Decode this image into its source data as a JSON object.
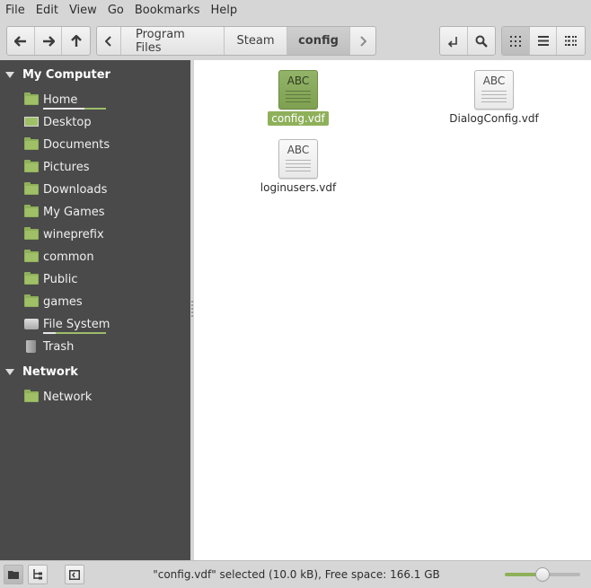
{
  "menu": [
    "File",
    "Edit",
    "View",
    "Go",
    "Bookmarks",
    "Help"
  ],
  "breadcrumb": [
    "Program Files",
    "Steam",
    "config"
  ],
  "sidebar": {
    "sections": [
      {
        "title": "My Computer",
        "items": [
          {
            "label": "Home",
            "icon": "home-folder-icon",
            "usage": 0.65
          },
          {
            "label": "Desktop",
            "icon": "desktop-icon"
          },
          {
            "label": "Documents",
            "icon": "documents-folder-icon"
          },
          {
            "label": "Pictures",
            "icon": "pictures-folder-icon"
          },
          {
            "label": "Downloads",
            "icon": "downloads-folder-icon"
          },
          {
            "label": "My Games",
            "icon": "folder-icon"
          },
          {
            "label": "wineprefix",
            "icon": "folder-icon"
          },
          {
            "label": "common",
            "icon": "folder-icon"
          },
          {
            "label": "Public",
            "icon": "public-folder-icon"
          },
          {
            "label": "games",
            "icon": "folder-icon"
          },
          {
            "label": "File System",
            "icon": "drive-icon",
            "usage": 0.2
          },
          {
            "label": "Trash",
            "icon": "trash-icon"
          }
        ]
      },
      {
        "title": "Network",
        "items": [
          {
            "label": "Network",
            "icon": "network-folder-icon"
          }
        ]
      }
    ]
  },
  "files": [
    {
      "name": "config.vdf",
      "selected": true,
      "icon_text": "ABC"
    },
    {
      "name": "DialogConfig.vdf",
      "selected": false,
      "icon_text": "ABC"
    },
    {
      "name": "loginusers.vdf",
      "selected": false,
      "icon_text": "ABC"
    }
  ],
  "status": "\"config.vdf\" selected (10.0 kB), Free space: 166.1 GB",
  "zoom_level": 0.5,
  "colors": {
    "accent": "#8fb05a",
    "sidebar_bg": "#4a4a4a"
  }
}
